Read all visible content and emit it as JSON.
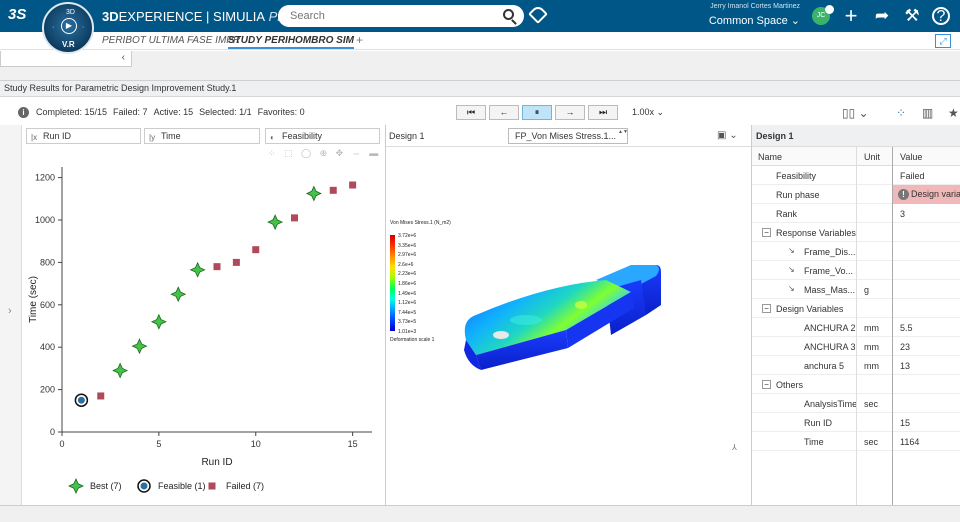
{
  "topbar": {
    "logo": "3S",
    "brand_a": "3D",
    "brand_b": "EXPERIENCE | SIMULIA",
    "brand_c": " Physic...",
    "search_placeholder": "Search",
    "user_name": "Jerry Imanol Cortes Martinez",
    "space": "Common Space ⌄",
    "avatar": "JC",
    "compass_n": "3D",
    "compass_vr": "V.R"
  },
  "tabs": {
    "tab1": "PERIBOT ULTIMA FASE IMPR",
    "tab2": "STUDY PERIHOMBRO SIM",
    "plus": "+"
  },
  "band": {
    "collapse": "‹"
  },
  "title": "Study Results for Parametric Design Improvement Study.1",
  "status": {
    "completed": "Completed: 15/15",
    "failed": "Failed: 7",
    "active": "Active: 15",
    "selected": "Selected: 1/1",
    "favorites": "Favorites: 0"
  },
  "controls": {
    "first": "⏮",
    "prev": "←",
    "pause": "⏸",
    "next": "→",
    "last": "⏭",
    "speed": "1.00x ⌄"
  },
  "axis_selectors": {
    "x": "Run ID",
    "y": "Time",
    "color": "Feasibility"
  },
  "chart_data": {
    "type": "scatter",
    "xlabel": "Run ID",
    "ylabel": "Time (sec)",
    "xlim": [
      0,
      16
    ],
    "ylim": [
      0,
      1250
    ],
    "xticks": [
      0,
      5,
      10,
      15
    ],
    "yticks": [
      0,
      200,
      400,
      600,
      800,
      1000,
      1200
    ],
    "grid": false,
    "legend_placement": "bottom",
    "series": [
      {
        "name": "Best (7)",
        "marker": "star4",
        "color": "#46c24a",
        "points": [
          [
            3,
            290
          ],
          [
            4,
            405
          ],
          [
            5,
            520
          ],
          [
            6,
            650
          ],
          [
            7,
            765
          ],
          [
            11,
            990
          ],
          [
            13,
            1125
          ]
        ]
      },
      {
        "name": "Feasible (1)",
        "marker": "circle",
        "color": "#2a6fa0",
        "points": [
          [
            1,
            150
          ]
        ]
      },
      {
        "name": "Failed (7)",
        "marker": "square",
        "color": "#b04a5a",
        "points": [
          [
            2,
            170
          ],
          [
            8,
            780
          ],
          [
            9,
            800
          ],
          [
            10,
            860
          ],
          [
            12,
            1010
          ],
          [
            14,
            1140
          ],
          [
            15,
            1165
          ]
        ]
      }
    ]
  },
  "viewer": {
    "design": "Design 1",
    "field": "FP_Von Mises Stress.1...",
    "legend_title": "Von Mises Stress.1 (N_m2)",
    "levels": [
      "3.72e+6",
      "3.35e+6",
      "2.97e+6",
      "2.6e+6",
      "2.23e+6",
      "1.86e+6",
      "1.49e+6",
      "1.12e+6",
      "7.44e+5",
      "3.73e+5",
      "1.01e+3"
    ],
    "deformation": "Deformation scale 1",
    "colors": {
      "low": "#0018ff",
      "high": "#d00000"
    }
  },
  "properties": {
    "title": "Design 1",
    "columns": {
      "name": "Name",
      "unit": "Unit",
      "value": "Value"
    },
    "rows": [
      {
        "name": "Feasibility",
        "unit": "",
        "value": "Failed",
        "indent": 1
      },
      {
        "name": "Run phase",
        "unit": "",
        "value": "Design varia",
        "indent": 1,
        "status": "fail"
      },
      {
        "name": "Rank",
        "unit": "",
        "value": "3",
        "indent": 1
      },
      {
        "name": "Response Variables",
        "unit": "",
        "value": "",
        "group": true
      },
      {
        "name": "Frame_Dis...",
        "unit": "",
        "value": "",
        "indent": 2,
        "sub": true
      },
      {
        "name": "Frame_Vo...",
        "unit": "",
        "value": "",
        "indent": 2,
        "sub": true
      },
      {
        "name": "Mass_Mas...",
        "unit": "g",
        "value": "",
        "indent": 2,
        "sub": true
      },
      {
        "name": "Design Variables",
        "unit": "",
        "value": "",
        "group": true
      },
      {
        "name": "ANCHURA 2",
        "unit": "mm",
        "value": "5.5",
        "indent": 2
      },
      {
        "name": "ANCHURA 3",
        "unit": "mm",
        "value": "23",
        "indent": 2
      },
      {
        "name": "anchura 5",
        "unit": "mm",
        "value": "13",
        "indent": 2
      },
      {
        "name": "Others",
        "unit": "",
        "value": "",
        "group": true
      },
      {
        "name": "AnalysisTime",
        "unit": "sec",
        "value": "",
        "indent": 2
      },
      {
        "name": "Run ID",
        "unit": "",
        "value": "15",
        "indent": 2
      },
      {
        "name": "Time",
        "unit": "sec",
        "value": "1164",
        "indent": 2
      }
    ]
  }
}
